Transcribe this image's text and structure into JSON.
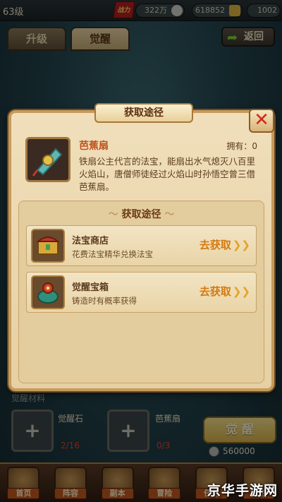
{
  "topbar": {
    "level": "63级",
    "power_value": "322万",
    "silver": "618852",
    "gold": "1002"
  },
  "tabs": [
    {
      "label": "升级"
    },
    {
      "label": "觉醒"
    }
  ],
  "back_button": {
    "label": "返回"
  },
  "materials": {
    "section_label": "觉醒材料",
    "items": [
      {
        "name": "觉醒石",
        "count": "2/16"
      },
      {
        "name": "芭蕉扇",
        "count": "0/3"
      }
    ]
  },
  "awaken_button": {
    "label": "觉 醒"
  },
  "coin_cost": "560000",
  "bottom_nav": [
    {
      "label": "首页"
    },
    {
      "label": "阵容"
    },
    {
      "label": "副本"
    },
    {
      "label": "冒险"
    },
    {
      "label": "任务"
    },
    {
      "label": "商店"
    }
  ],
  "watermark": "京华手游网",
  "modal": {
    "title": "获取途径",
    "close_label": "✕",
    "item": {
      "name": "芭蕉扇",
      "owned_label": "拥有：",
      "owned_value": "0",
      "description": "铁扇公主代言的法宝，能扇出水气熄灭八百里火焰山，唐僧师徒经过火焰山时孙悟空曾三借芭蕉扇。"
    },
    "sources_title": "获取途径",
    "sources": [
      {
        "name": "法宝商店",
        "desc": "花费法宝精华兑换法宝",
        "action": "去获取"
      },
      {
        "name": "觉醒宝箱",
        "desc": "铸造时有概率获得",
        "action": "去获取"
      }
    ]
  },
  "colors": {
    "modal_bg": "#f0dfbb",
    "accent_orange": "#d47a12",
    "item_name": "#c0501c",
    "close_red": "#cf2a1a"
  }
}
